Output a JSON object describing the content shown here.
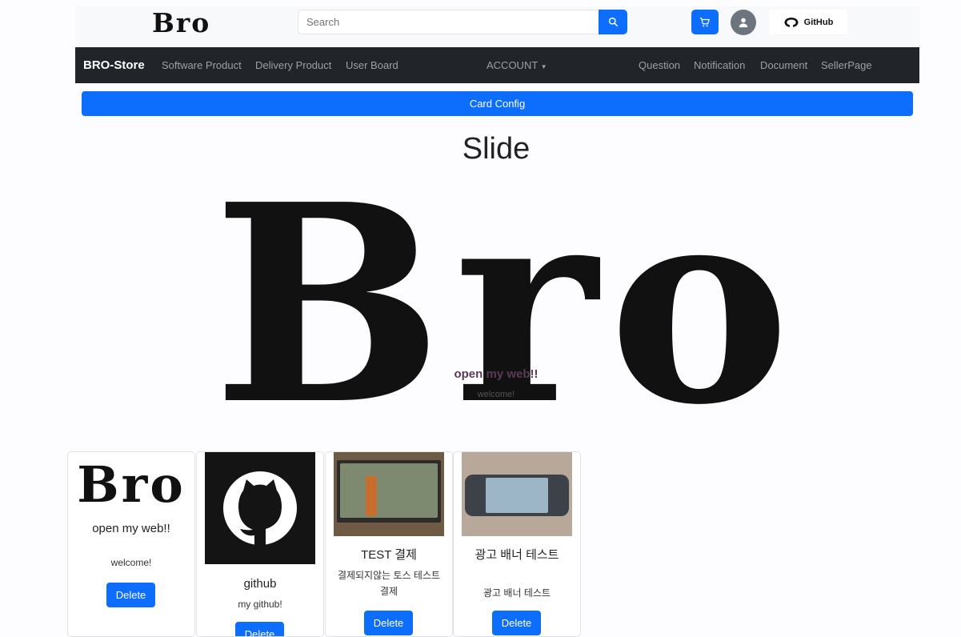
{
  "header": {
    "logo": "Bro",
    "search_placeholder": "Search",
    "github_label": "GitHub"
  },
  "navbar": {
    "brand": "BRO-Store",
    "left_links": [
      "Software Product",
      "Delivery Product",
      "User Board"
    ],
    "account": "ACCOUNT",
    "right_links": [
      "Question",
      "Notification",
      "Document",
      "SellerPage"
    ]
  },
  "card_config_label": "Card Config",
  "slide": {
    "title": "Slide",
    "hero_text": "Bro",
    "caption_title": "open my web!!",
    "caption_subtitle": "welcome!"
  },
  "cards": [
    {
      "image_text": "Bro",
      "title": "open my web!!",
      "text": "welcome!",
      "button": "Delete"
    },
    {
      "title": "github",
      "text": "my github!",
      "button": "Delete"
    },
    {
      "title": "TEST 결제",
      "text": "결제되지않는 토스 테스트결제",
      "button": "Delete"
    },
    {
      "title": "광고 배너 테스트",
      "text": "광고 배너 테스트",
      "button": "Delete"
    }
  ],
  "colors": {
    "primary": "#0d6efd",
    "navbar": "#212529",
    "topbar": "#f8f9fa"
  },
  "icons": [
    "search-icon",
    "cart-icon",
    "user-icon",
    "github-icon"
  ]
}
